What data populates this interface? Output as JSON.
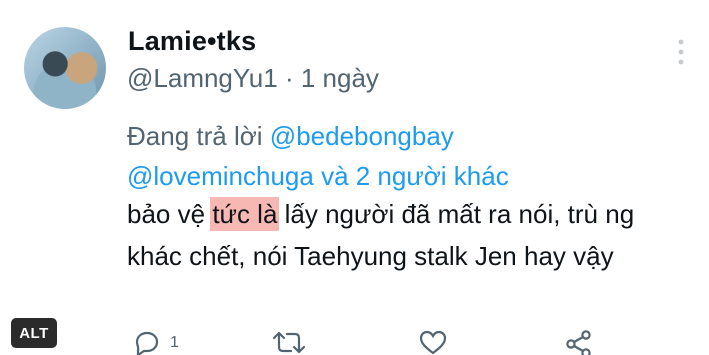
{
  "tweet": {
    "display_name": "Lamie•tks",
    "handle": "@LamngYu1",
    "separator": "·",
    "time": "1 ngày",
    "reply_prefix": "Đang trả lời",
    "mention_1": "@bedebongbay",
    "mention_2": "@loveminchuga",
    "reply_suffix": "và 2 người khác",
    "text_before": "bảo vệ",
    "text_highlight": "tức là",
    "text_after": "lấy người đã mất ra nói, trù ng khác chết, nói Taehyung stalk Jen hay vậy",
    "highlight_color": "#f7b7b3"
  },
  "alt_badge": "ALT",
  "actions": {
    "reply_count": "1"
  },
  "colors": {
    "mention": "#1d9bf0",
    "secondary_text": "#536471",
    "primary_text": "#0f1419"
  }
}
